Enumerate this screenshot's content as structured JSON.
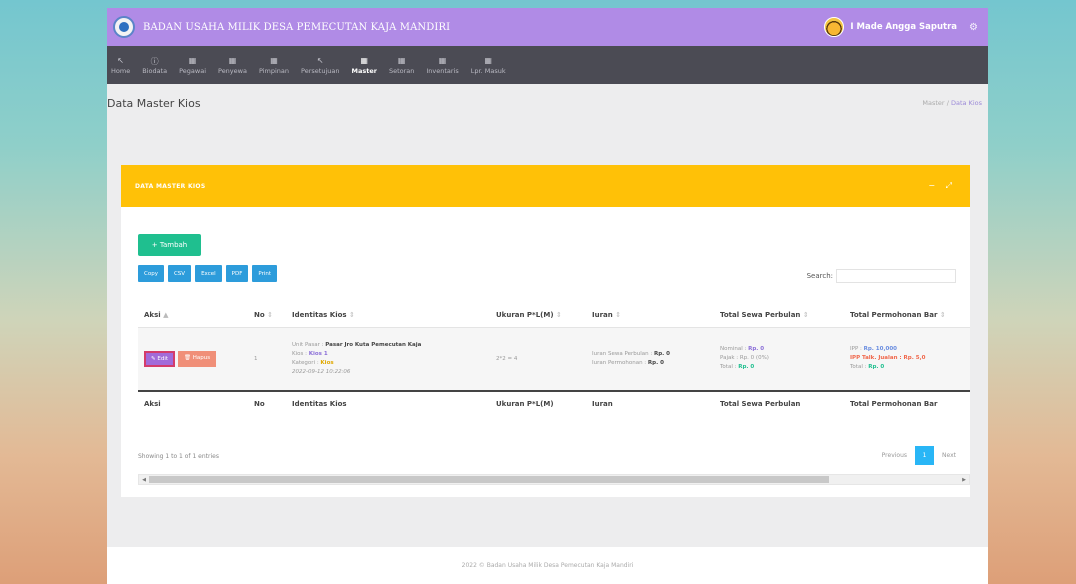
{
  "app": {
    "title": "BADAN USAHA MILIK DESA PEMECUTAN KAJA MANDIRI",
    "user": "I Made Angga Saputra"
  },
  "nav": [
    {
      "label": "Home",
      "icon": "home-icon",
      "glyph": "↖"
    },
    {
      "label": "Biodata",
      "icon": "info-icon",
      "glyph": "ⓘ"
    },
    {
      "label": "Pegawai",
      "icon": "grid-icon",
      "glyph": "▦"
    },
    {
      "label": "Penyewa",
      "icon": "grid-icon",
      "glyph": "▦"
    },
    {
      "label": "Pimpinan",
      "icon": "grid-icon",
      "glyph": "▦"
    },
    {
      "label": "Persetujuan",
      "icon": "home-icon",
      "glyph": "↖"
    },
    {
      "label": "Master",
      "icon": "grid-icon",
      "glyph": "▦",
      "active": true
    },
    {
      "label": "Setoran",
      "icon": "grid-icon",
      "glyph": "▦"
    },
    {
      "label": "Inventaris",
      "icon": "grid-icon",
      "glyph": "▦"
    },
    {
      "label": "Lpr. Masuk",
      "icon": "grid-icon",
      "glyph": "▦"
    }
  ],
  "page": {
    "title": "Data Master Kios",
    "breadcrumb_root": "Master",
    "breadcrumb_sep": "/",
    "breadcrumb_current": "Data Kios"
  },
  "card": {
    "title": "DATA MASTER KIOS",
    "tools": "− ⤢"
  },
  "add_button": "+ Tambah",
  "exports": [
    "Copy",
    "CSV",
    "Excel",
    "PDF",
    "Print"
  ],
  "search_label": "Search:",
  "columns": [
    "Aksi",
    "No",
    "Identitas Kios",
    "Ukuran P*L(M)",
    "Iuran",
    "Total Sewa Perbulan",
    "Total Permohonan Bar"
  ],
  "sort_marks": [
    "▲",
    "⇕",
    "⇕",
    "⇕",
    "⇕",
    "⇕",
    "⇕"
  ],
  "row": {
    "edit": "✎ Edit",
    "delete": "🗑 Hapus",
    "no": "1",
    "unit_label": "Unit Pasar :",
    "unit_value": "Pasar Jro Kuta Pemecutan Kaja",
    "kios_label": "Kios :",
    "kios_value": "Kios 1",
    "kategori_label": "Kategori :",
    "kategori_value": "Kios",
    "datetime": "2022-09-12 10:22:06",
    "ukuran": "2*2 = 4",
    "iuran_sewa_label": "Iuran Sewa Perbulan :",
    "iuran_sewa_value": "Rp. 0",
    "iuran_perm_label": "Iuran Permohonan :",
    "iuran_perm_value": "Rp. 0",
    "nominal_label": "Nominal :",
    "nominal_value": "Rp. 0",
    "pajak_label": "Pajak : Rp. 0 (0%)",
    "total_label": "Total :",
    "total_value": "Rp. 0",
    "ipp_label": "IPP :",
    "ipp_value": "Rp. 10,000",
    "ipp_talk_label": "IPP Talk. Jualan :",
    "ipp_talk_value": "Rp. 5,0",
    "total2_label": "Total :",
    "total2_value": "Rp. 0"
  },
  "showing": "Showing 1 to 1 of 1 entries",
  "pager": {
    "prev": "Previous",
    "page": "1",
    "next": "Next"
  },
  "footer": "2022 © Badan Usaha Milik Desa Pemecutan Kaja Mandiri"
}
